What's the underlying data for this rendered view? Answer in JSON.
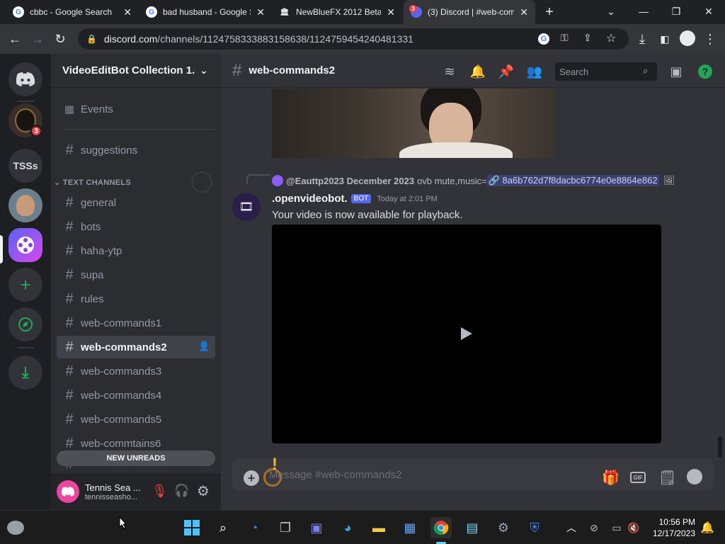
{
  "browser": {
    "tabs": [
      {
        "title": "cbbc - Google Search",
        "icon": "google-icon"
      },
      {
        "title": "bad husband - Google Search",
        "icon": "google-icon"
      },
      {
        "title": "NewBlueFX 2012 Beta Tools",
        "icon": "archive-icon"
      },
      {
        "title": "(3) Discord | #web-commands2",
        "icon": "discord-icon",
        "active": true,
        "badge": "3"
      }
    ],
    "new_tab": "+",
    "url": {
      "host": "discord.com",
      "path": "/channels/1124758333883158638/1124759454240481331"
    }
  },
  "guilds": {
    "items": [
      {
        "name": "Direct Messages",
        "icon": "discord-logo-icon"
      },
      {
        "name": "server-avatar-1",
        "badge": "3"
      },
      {
        "name": "TSSs",
        "label": "TSSs"
      },
      {
        "name": "server-avatar-3"
      },
      {
        "name": "VideoEditBot Collection",
        "active": true
      },
      {
        "name": "Add a Server",
        "icon": "plus-icon"
      },
      {
        "name": "Explore Discoverable Servers",
        "icon": "compass-icon"
      },
      {
        "name": "Download Apps",
        "icon": "download-icon"
      }
    ]
  },
  "server": {
    "name": "VideoEditBot Collection 1.0",
    "events_label": "Events",
    "top_channels": [
      "suggestions"
    ],
    "category_label": "TEXT CHANNELS",
    "channels": [
      "general",
      "bots",
      "haha-ytp",
      "supa",
      "rules",
      "web-commands1",
      "web-commands2",
      "web-commands3",
      "web-commands4",
      "web-commands5",
      "web-commtains6",
      "web-commands7"
    ],
    "active_channel": "web-commands2",
    "new_unreads": "NEW UNREADS"
  },
  "user": {
    "name": "Tennis Sea ...",
    "tag": "tennisseasho..."
  },
  "chat": {
    "channel": "web-commands2",
    "search_placeholder": "Search",
    "reply": {
      "author": "@Eauttp2023 December 2023",
      "content": "ovb mute,music=",
      "link": "8a6b762d7f8dacbc6774e0e8864e862"
    },
    "message": {
      "author": ".openvideobot.",
      "bot_tag": "BOT",
      "timestamp": "Today at 2:01 PM",
      "text": "Your video is now available for playback."
    },
    "composer_placeholder": "Message #web-commands2"
  },
  "taskbar": {
    "time": "10:56 PM",
    "date": "12/17/2023"
  }
}
